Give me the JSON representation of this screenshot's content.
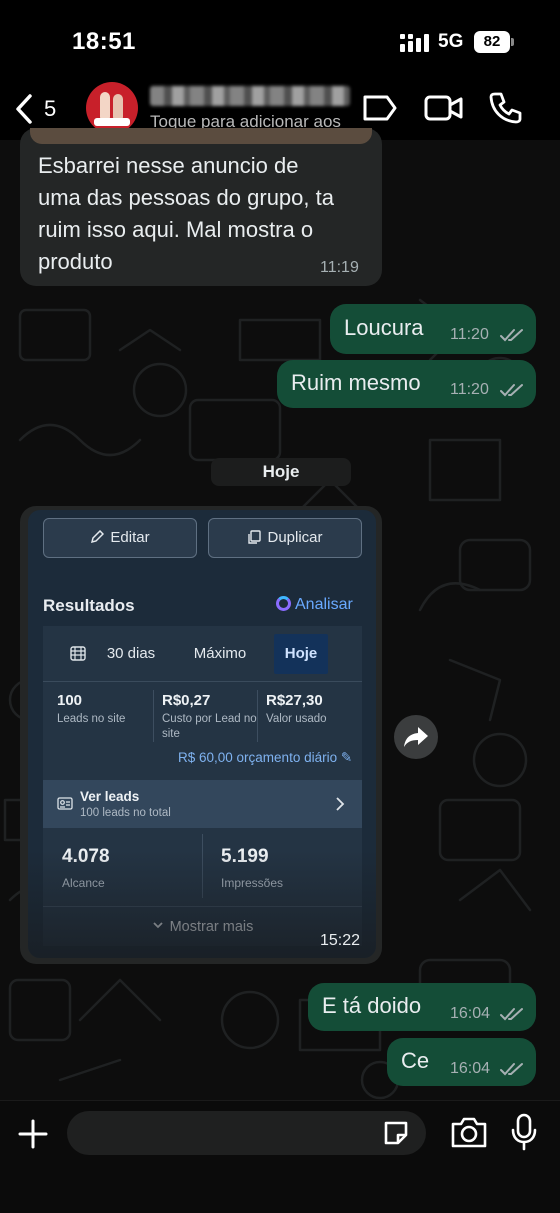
{
  "status_bar": {
    "time": "18:51",
    "network": "5G",
    "battery": "82"
  },
  "header": {
    "back_count": "5",
    "subtitle": "Toque para adicionar aos"
  },
  "messages": [
    {
      "direction": "incoming",
      "lines": [
        "Esbarrei nesse anuncio de",
        "uma das pessoas do grupo, ta",
        "ruim isso aqui. Mal mostra o",
        "produto"
      ],
      "time": "11:19"
    },
    {
      "direction": "outgoing",
      "text": "Loucura",
      "time": "11:20",
      "status": "read"
    },
    {
      "direction": "outgoing",
      "text": "Ruim mesmo",
      "time": "11:20",
      "status": "read"
    }
  ],
  "day_separator": "Hoje",
  "screenshot_message": {
    "time": "15:22",
    "buttons": {
      "edit": "Editar",
      "duplicate": "Duplicar"
    },
    "results_title": "Resultados",
    "analyze": "Analisar",
    "tabs": [
      "30 dias",
      "Máximo",
      "Hoje"
    ],
    "active_tab": "Hoje",
    "metrics": [
      {
        "value": "100",
        "label_1": "Leads no site",
        "label_2": ""
      },
      {
        "value": "R$0,27",
        "label_1": "Custo por Lead no",
        "label_2": "site"
      },
      {
        "value": "R$27,30",
        "label_1": "Valor usado",
        "label_2": ""
      }
    ],
    "budget": "R$ 60,00 orçamento diário",
    "leads": {
      "title": "Ver leads",
      "subtitle": "100 leads no total"
    },
    "reach": {
      "value": "4.078",
      "label": "Alcance"
    },
    "impressions": {
      "value": "5.199",
      "label": "Impressões"
    },
    "show_more": "Mostrar mais"
  },
  "later_messages": [
    {
      "direction": "outgoing",
      "text": "E tá doido",
      "time": "16:04",
      "status": "read"
    },
    {
      "direction": "outgoing",
      "text": "Ce",
      "time": "16:04",
      "status": "read"
    }
  ],
  "input": {
    "placeholder": ""
  },
  "colors": {
    "incoming_bubble": "#242626",
    "outgoing_bubble": "#144d37",
    "background": "#0b0b0b",
    "link_blue": "#69a9ff"
  },
  "icons": [
    "chevron-left-icon",
    "video-call-icon",
    "phone-icon",
    "label-icon",
    "plus-icon",
    "sticker-icon",
    "camera-icon",
    "mic-icon",
    "forward-icon",
    "double-check-icon"
  ]
}
